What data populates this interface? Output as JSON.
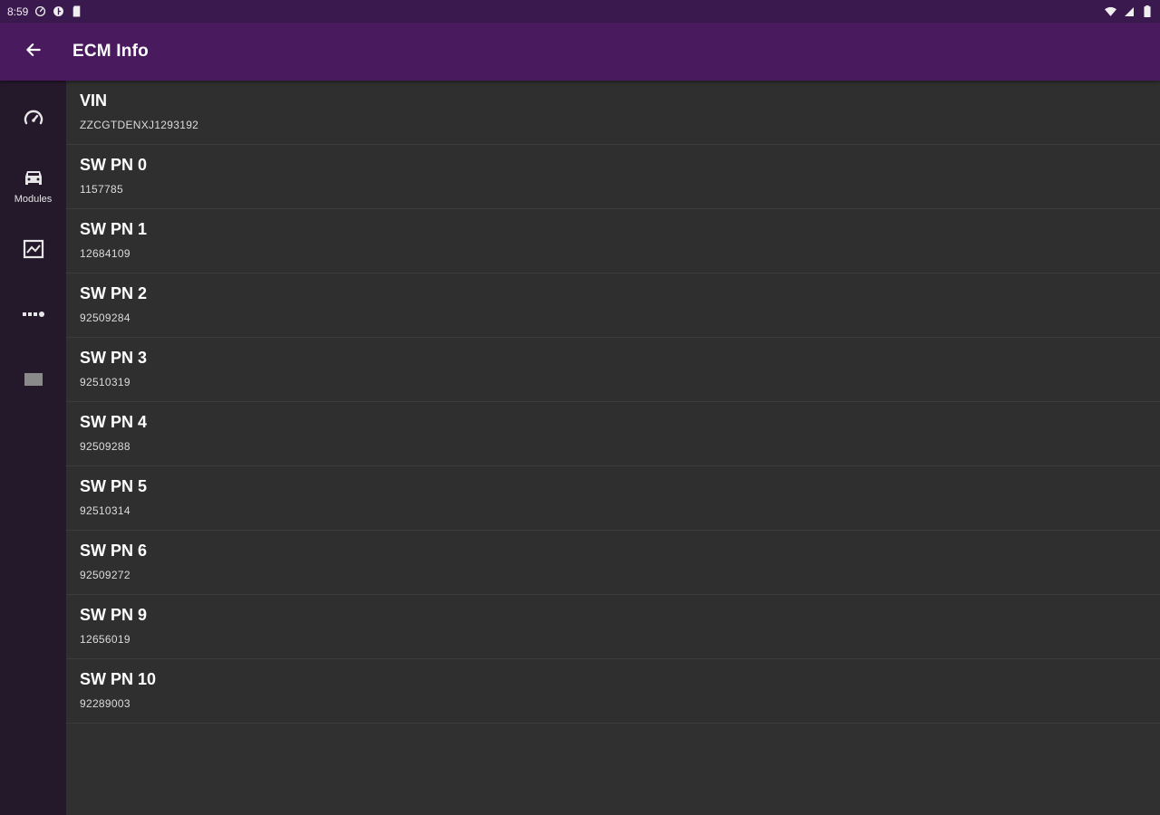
{
  "status_bar": {
    "time": "8:59",
    "left_icons": [
      "speedometer-icon",
      "circle-half-icon",
      "sd-card-icon"
    ],
    "right_icons": [
      "wifi-icon",
      "signal-icon",
      "battery-icon"
    ]
  },
  "app_bar": {
    "title": "ECM Info",
    "back_icon": "arrow-left-icon",
    "color": "#4a1a5e"
  },
  "nav_rail": {
    "items": [
      {
        "icon": "speedometer-icon",
        "label": ""
      },
      {
        "icon": "car-icon",
        "label": "Modules"
      },
      {
        "icon": "chart-icon",
        "label": ""
      },
      {
        "icon": "dots-icon",
        "label": ""
      },
      {
        "icon": "rectangle-icon",
        "label": ""
      }
    ]
  },
  "info_items": [
    {
      "label": "VIN",
      "value": "ZZCGTDENXJ1293192"
    },
    {
      "label": "SW PN 0",
      "value": "1157785"
    },
    {
      "label": "SW PN 1",
      "value": "12684109"
    },
    {
      "label": "SW PN 2",
      "value": "92509284"
    },
    {
      "label": "SW PN 3",
      "value": "92510319"
    },
    {
      "label": "SW PN 4",
      "value": "92509288"
    },
    {
      "label": "SW PN 5",
      "value": "92510314"
    },
    {
      "label": "SW PN 6",
      "value": "92509272"
    },
    {
      "label": "SW PN 9",
      "value": "12656019"
    },
    {
      "label": "SW PN 10",
      "value": "92289003"
    }
  ]
}
